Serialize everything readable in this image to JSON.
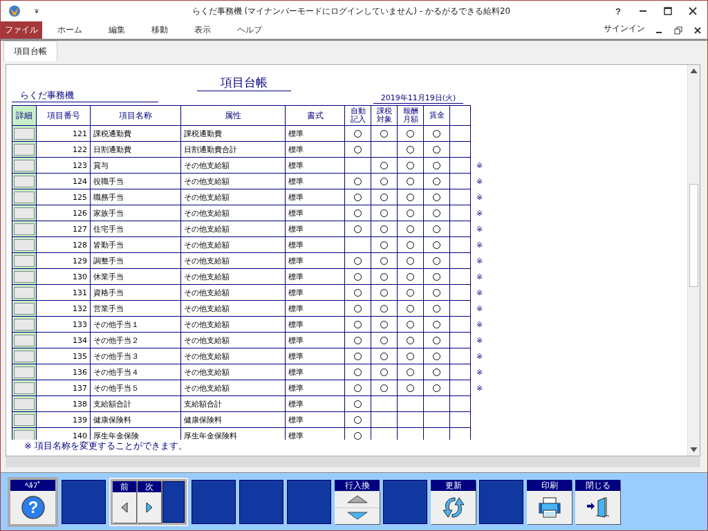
{
  "window": {
    "title": "らくだ事務機 (マイナンバーモードにログインしていません) - かるがるできる給料20",
    "help": "?",
    "signin": "サインイン"
  },
  "menu": [
    {
      "label": "ファイル",
      "selected": true
    },
    {
      "label": "ホーム",
      "selected": false
    },
    {
      "label": "編集",
      "selected": false
    },
    {
      "label": "移動",
      "selected": false
    },
    {
      "label": "表示",
      "selected": false
    },
    {
      "label": "ヘルプ",
      "selected": false
    }
  ],
  "tabs": [
    {
      "label": "項目台帳",
      "selected": true
    }
  ],
  "document": {
    "title": "項目台帳",
    "company": "らくだ事務機",
    "date": "2019年11月19日(火)",
    "footnote": "※ 項目名称を変更することができます。"
  },
  "table": {
    "columns": [
      "詳細",
      "項目番号",
      "項目名称",
      "属性",
      "書式",
      "自動記入",
      "課税対象",
      "報酬月額",
      "賃金"
    ],
    "rows": [
      {
        "no": "121",
        "name": "課税通勤費",
        "attr": "課税通勤費",
        "format": "標準",
        "marks": [
          true,
          true,
          true,
          true
        ]
      },
      {
        "no": "122",
        "name": "日割通勤費",
        "attr": "日割通勤費合計",
        "format": "標準",
        "marks": [
          true,
          false,
          true,
          true
        ]
      },
      {
        "no": "123",
        "name": "賞与",
        "attr": "その他支給額",
        "format": "標準",
        "marks": [
          false,
          true,
          true,
          true
        ],
        "note": "※"
      },
      {
        "no": "124",
        "name": "役職手当",
        "attr": "その他支給額",
        "format": "標準",
        "marks": [
          true,
          true,
          true,
          true
        ],
        "note": "※"
      },
      {
        "no": "125",
        "name": "職務手当",
        "attr": "その他支給額",
        "format": "標準",
        "marks": [
          true,
          true,
          true,
          true
        ],
        "note": "※"
      },
      {
        "no": "126",
        "name": "家族手当",
        "attr": "その他支給額",
        "format": "標準",
        "marks": [
          true,
          true,
          true,
          true
        ],
        "note": "※"
      },
      {
        "no": "127",
        "name": "住宅手当",
        "attr": "その他支給額",
        "format": "標準",
        "marks": [
          true,
          true,
          true,
          true
        ],
        "note": "※"
      },
      {
        "no": "128",
        "name": "皆勤手当",
        "attr": "その他支給額",
        "format": "標準",
        "marks": [
          false,
          true,
          true,
          true
        ],
        "note": "※"
      },
      {
        "no": "129",
        "name": "調整手当",
        "attr": "その他支給額",
        "format": "標準",
        "marks": [
          true,
          true,
          true,
          true
        ],
        "note": "※"
      },
      {
        "no": "130",
        "name": "休業手当",
        "attr": "その他支給額",
        "format": "標準",
        "marks": [
          true,
          true,
          true,
          true
        ],
        "note": "※"
      },
      {
        "no": "131",
        "name": "資格手当",
        "attr": "その他支給額",
        "format": "標準",
        "marks": [
          true,
          true,
          true,
          true
        ],
        "note": "※"
      },
      {
        "no": "132",
        "name": "営業手当",
        "attr": "その他支給額",
        "format": "標準",
        "marks": [
          true,
          true,
          true,
          true
        ],
        "note": "※"
      },
      {
        "no": "133",
        "name": "その他手当１",
        "attr": "その他支給額",
        "format": "標準",
        "marks": [
          true,
          true,
          true,
          true
        ],
        "note": "※"
      },
      {
        "no": "134",
        "name": "その他手当２",
        "attr": "その他支給額",
        "format": "標準",
        "marks": [
          true,
          true,
          true,
          true
        ],
        "note": "※"
      },
      {
        "no": "135",
        "name": "その他手当３",
        "attr": "その他支給額",
        "format": "標準",
        "marks": [
          true,
          true,
          true,
          true
        ],
        "note": "※"
      },
      {
        "no": "136",
        "name": "その他手当４",
        "attr": "その他支給額",
        "format": "標準",
        "marks": [
          true,
          true,
          true,
          true
        ],
        "note": "※"
      },
      {
        "no": "137",
        "name": "その他手当５",
        "attr": "その他支給額",
        "format": "標準",
        "marks": [
          true,
          true,
          true,
          true
        ],
        "note": "※"
      },
      {
        "no": "138",
        "name": "支給額合計",
        "attr": "支給額合計",
        "format": "標準",
        "marks": [
          true,
          false,
          false,
          false
        ]
      },
      {
        "no": "139",
        "name": "健康保険料",
        "attr": "健康保険料",
        "format": "標準",
        "marks": [
          true,
          false,
          false,
          false
        ]
      },
      {
        "no": "140",
        "name": "厚生年金保険",
        "attr": "厚生年金保険料",
        "format": "標準",
        "marks": [
          true,
          false,
          false,
          false
        ]
      }
    ]
  },
  "toolbar": [
    {
      "kind": "help",
      "label": "ﾍﾙﾌﾟ",
      "glyph": "?"
    },
    {
      "kind": "blank"
    },
    {
      "kind": "nav",
      "labels": [
        "前",
        "次"
      ]
    },
    {
      "kind": "blank"
    },
    {
      "kind": "blank"
    },
    {
      "kind": "blank"
    },
    {
      "kind": "updown",
      "label": "行入換"
    },
    {
      "kind": "blank"
    },
    {
      "kind": "refresh",
      "label": "更新"
    },
    {
      "kind": "blank"
    },
    {
      "kind": "print",
      "label": "印刷"
    },
    {
      "kind": "exit",
      "label": "閉じる"
    }
  ]
}
